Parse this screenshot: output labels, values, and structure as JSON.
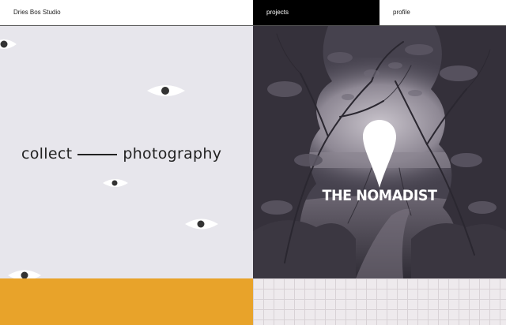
{
  "nav": {
    "brand": "Dries Bos Studio",
    "projects": "projects",
    "profile": "profile"
  },
  "left_panel": {
    "word_left": "collect",
    "word_right": "photography"
  },
  "right_panel": {
    "title": "THE NOMADIST"
  },
  "colors": {
    "accent_orange": "#e8a32a",
    "nav_active": "#000000",
    "panel_lavender": "#e7e6ec"
  },
  "icons": [
    "eye-icon",
    "map-pin-icon"
  ]
}
